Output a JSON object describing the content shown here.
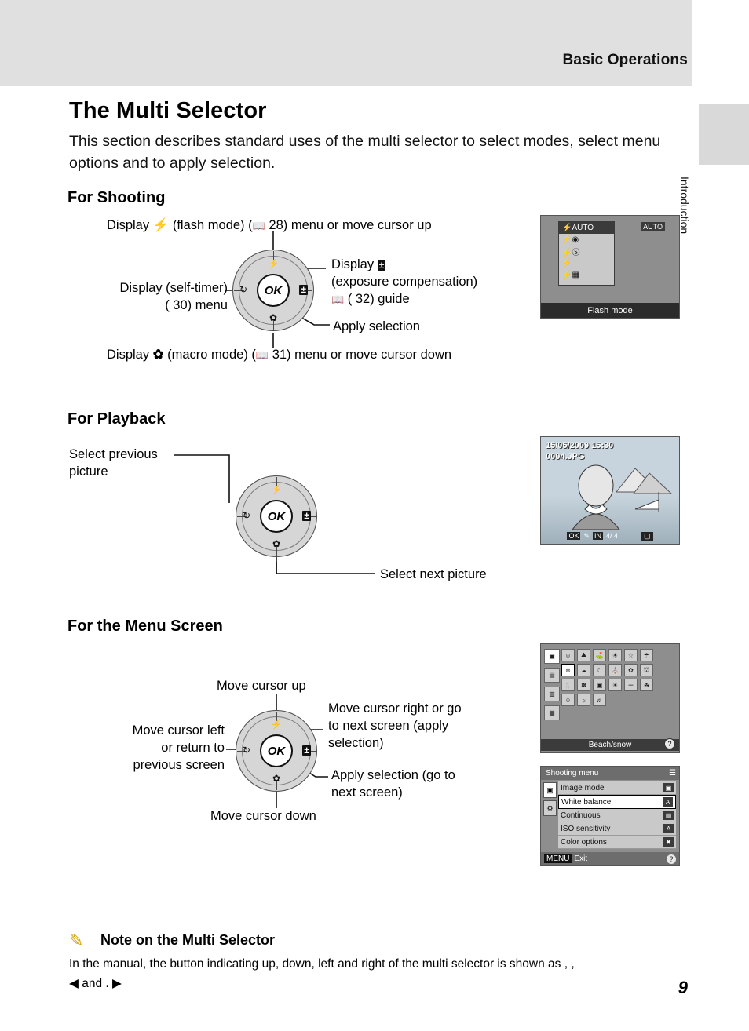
{
  "header": {
    "running_head": "Basic Operations",
    "side_tab_label": "Introduction"
  },
  "title": "The Multi Selector",
  "intro": "This section describes standard uses of the multi selector to select modes, select menu options and to apply selection.",
  "sections": {
    "shooting": {
      "heading": "For Shooting",
      "labels": {
        "up": "Display   (flash mode) (  28) menu or move cursor up",
        "up_pre": "Display",
        "up_post": "(flash mode) (",
        "up_page": "28) menu or move cursor up",
        "left_line1": "Display   (self-timer)",
        "left_line2": "(  30) menu",
        "right_line1": "Display",
        "right_line2": "(exposure compensation)",
        "right_line3": "(  32) guide",
        "apply": "Apply selection",
        "down_pre": "Display",
        "down_post": "(macro mode) (",
        "down_page": "31) menu or move cursor down"
      }
    },
    "playback": {
      "heading": "For Playback",
      "labels": {
        "prev_line1": "Select previous",
        "prev_line2": "picture",
        "next": "Select next picture"
      }
    },
    "menu": {
      "heading": "For the Menu Screen",
      "labels": {
        "up": "Move cursor up",
        "left_line1": "Move cursor left",
        "left_line2": "or return to",
        "left_line3": "previous screen",
        "right_line1": "Move cursor right or go",
        "right_line2": "to next screen (apply",
        "right_line3": "selection)",
        "apply_line1": "Apply selection (go to",
        "apply_line2": "next screen)",
        "down": "Move cursor down"
      }
    }
  },
  "dial": {
    "ok_label": "OK",
    "icon_top": "flash-icon",
    "icon_left": "self-timer-icon",
    "icon_right": "exposure-compensation-icon",
    "icon_bottom": "macro-icon"
  },
  "screens": {
    "flash": {
      "caption": "Flash mode",
      "top_right_badge": "AUTO",
      "items": [
        "AUTO",
        "red-eye",
        "off",
        "fill-flash",
        "slow-sync"
      ],
      "selected_index": 0,
      "selected_label": "AUTO"
    },
    "playback": {
      "date": "15/05/2009 15:30",
      "filename": "0004.JPG",
      "counter": "4/ 4"
    },
    "scene": {
      "caption": "Beach/snow",
      "rows": [
        [
          "portrait",
          "landscape",
          "sports",
          "night-portrait",
          "party",
          "beach"
        ],
        [
          "snow",
          "sunset",
          "dusk",
          "night-landscape",
          "close-up",
          "museum"
        ],
        [
          "food",
          "fireworks",
          "copy",
          "backlight",
          "panorama",
          "pet"
        ],
        [
          "smile",
          "blink",
          "voice"
        ]
      ],
      "left_tabs": [
        "scene",
        "movie",
        "setup"
      ]
    },
    "shooting_menu": {
      "title": "Shooting menu",
      "items": [
        "Image mode",
        "White balance",
        "Continuous",
        "ISO sensitivity",
        "Color options"
      ],
      "selected_index": 1,
      "footer": "Exit",
      "footer_badge": "MENU"
    }
  },
  "note": {
    "heading": "Note on the Multi Selector",
    "body_line1": "In the manual, the button indicating up, down, left and right of the multi selector is shown as   ,   ,",
    "body_line2": "and   ."
  },
  "page_number": "9",
  "colors": {
    "header_band": "#e0e0e0",
    "side_tab": "#d9d9d9",
    "pencil": "#d8a200"
  }
}
